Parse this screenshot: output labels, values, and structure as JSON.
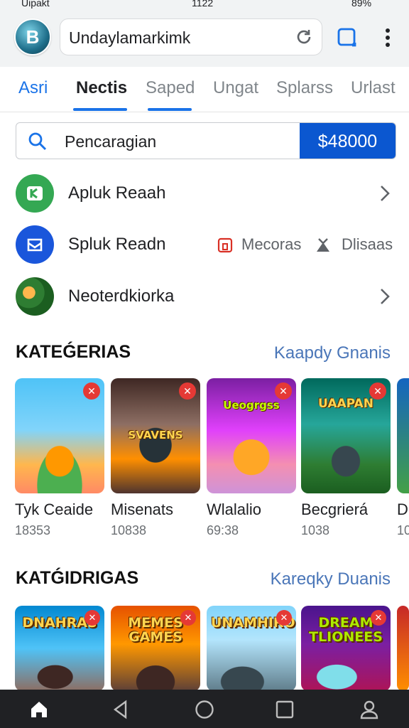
{
  "status": {
    "carrier": "Uipakt",
    "time": "1122",
    "battery": "89%"
  },
  "browser": {
    "url": "Undaylamarkimk",
    "avatar_letter": "B"
  },
  "tabs": [
    {
      "label": "Asri"
    },
    {
      "label": "Nectis"
    },
    {
      "label": "Saped"
    },
    {
      "label": "Ungat"
    },
    {
      "label": "Splarss"
    },
    {
      "label": "Urlast"
    }
  ],
  "search": {
    "text": "Pencaragian",
    "price": "$48000"
  },
  "list": [
    {
      "label": "Apluk Reaah"
    },
    {
      "label": "Spluk Readn",
      "extra1": "Mecoras",
      "extra2": "Dlisaas"
    },
    {
      "label": "Neoterdkiorka"
    }
  ],
  "section1": {
    "title": "KATEǴERIAS",
    "link": "Kaapdy Gnanis",
    "cards": [
      {
        "title": "Tyk Ceaide",
        "sub": "18353",
        "banner": ""
      },
      {
        "title": "Misenats",
        "sub": "10838",
        "banner": "SVAVENS"
      },
      {
        "title": "Wlalalio",
        "sub": "69:38",
        "banner": "Ueogrgss"
      },
      {
        "title": "Becgrierá",
        "sub": "1038",
        "banner": "UAAPAN"
      },
      {
        "title": "D",
        "sub": "10",
        "banner": ""
      }
    ]
  },
  "section2": {
    "title": "KATǴIDRIGAS",
    "link": "Kareqky Duanis",
    "cards": [
      {
        "banner": "DNAHRAS"
      },
      {
        "banner": "MEMES GAMES"
      },
      {
        "banner": "UNAMHIRO"
      },
      {
        "banner": "DREAM TLIONEES"
      }
    ]
  },
  "colors": {
    "accent": "#1a73e8",
    "price_bg": "#0b57d0",
    "nav_bg": "#202124"
  },
  "icons": [
    "signal-icon",
    "wifi-icon",
    "reload-icon",
    "tabs-icon",
    "menu-icon",
    "search-icon",
    "chevron-right-icon",
    "bookmark-icon",
    "download-icon",
    "home-icon",
    "back-icon",
    "circle-home-icon",
    "recents-icon",
    "profile-icon"
  ]
}
